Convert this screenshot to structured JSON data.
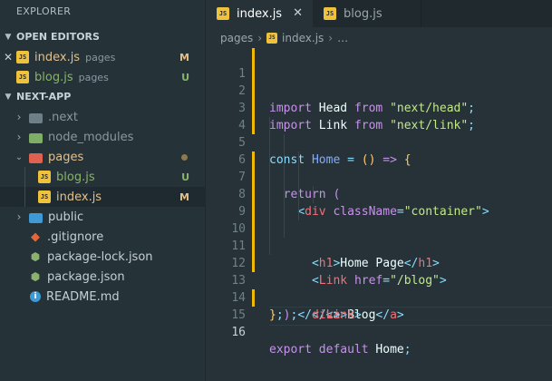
{
  "explorer": {
    "title": "EXPLORER",
    "open_editors": {
      "header": "OPEN EDITORS",
      "items": [
        {
          "name": "index.js",
          "hint": "pages",
          "status": "M"
        },
        {
          "name": "blog.js",
          "hint": "pages",
          "status": "U"
        }
      ]
    },
    "project": {
      "header": "NEXT-APP",
      "items": [
        {
          "name": ".next",
          "icon": "folder-icon"
        },
        {
          "name": "node_modules",
          "icon": "node-folder-icon"
        },
        {
          "name": "pages",
          "icon": "pages-folder-icon"
        },
        {
          "name": "blog.js",
          "status": "U"
        },
        {
          "name": "index.js",
          "status": "M"
        },
        {
          "name": "public",
          "icon": "public-folder-icon"
        },
        {
          "name": ".gitignore",
          "icon": "git-icon"
        },
        {
          "name": "package-lock.json",
          "icon": "json-icon"
        },
        {
          "name": "package.json",
          "icon": "json-icon"
        },
        {
          "name": "README.md",
          "icon": "info-icon"
        }
      ]
    }
  },
  "tabs": [
    {
      "label": "index.js",
      "active": true,
      "close": "✕"
    },
    {
      "label": "blog.js",
      "active": false
    }
  ],
  "breadcrumb": {
    "folder": "pages",
    "file": "index.js",
    "rest": "…"
  },
  "code": {
    "line_numbers": [
      "1",
      "2",
      "3",
      "4",
      "5",
      "6",
      "7",
      "8",
      "9",
      "10",
      "11",
      "12",
      "13",
      "14",
      "15",
      "16"
    ],
    "current_line": 16,
    "l1": {
      "kw": "import",
      "id": "Head",
      "from": "from",
      "str": "\"next/head\"",
      "end": ";"
    },
    "l2": {
      "kw": "import",
      "id": "Link",
      "from": "from",
      "str": "\"next/link\"",
      "end": ";"
    },
    "l4": {
      "kw": "const",
      "id": "Home",
      "eq": "=",
      "parens": "()",
      "arrow": "=>",
      "brace": "{"
    },
    "l5": {
      "kw": "return",
      "paren": "("
    },
    "l6": {
      "lt": "<",
      "tag": "div",
      "attr": "className",
      "eq": "=",
      "str": "\"container\"",
      "gt": ">"
    },
    "l7": {
      "lt": "<",
      "tag": "h1",
      "gt": ">",
      "text": "Home Page",
      "close_lt": "</",
      "close_tag": "h1",
      "close_gt": ">"
    },
    "l8": {
      "lt": "<",
      "tag": "Link",
      "attr": "href",
      "eq": "=",
      "str": "\"/blog\"",
      "gt": ">"
    },
    "l9": {
      "lt": "<",
      "tag": "a",
      "gt": ">",
      "text": "Blog",
      "close_lt": "</",
      "close_tag": "a",
      "close_gt": ">"
    },
    "l10": {
      "lt": "</",
      "tag": "Link",
      "gt": ">"
    },
    "l11": {
      "lt": "</",
      "tag": "div",
      "gt": ">"
    },
    "l12": {
      "paren": ")",
      "end": ";"
    },
    "l13": {
      "brace": "}",
      "end": ";"
    },
    "l15": {
      "kw": "export",
      "kw2": "default",
      "id": "Home",
      "end": ";"
    }
  },
  "colors": {
    "accent_tab_underline": "#263238",
    "git_modified": "#e2c08d",
    "git_untracked": "#8ab26e",
    "gutter_change": "#f0b800"
  }
}
